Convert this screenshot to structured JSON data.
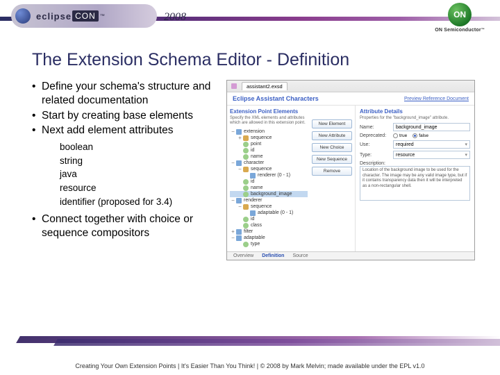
{
  "header": {
    "logo_main": "eclipse",
    "logo_con": "CON",
    "tm": "™",
    "year": "2008",
    "on_text": "ON",
    "on_sub": "ON Semiconductor",
    "on_tm": "™"
  },
  "title": "The Extension Schema Editor - Definition",
  "bullets": {
    "b1": "Define your schema's structure and related documentation",
    "b2": "Start by creating base elements",
    "b3": "Next add element attributes",
    "sub1": "boolean",
    "sub2": "string",
    "sub3": "java",
    "sub4": "resource",
    "sub5": "identifier (proposed for 3.4)",
    "b4": "Connect together with choice or sequence compositors"
  },
  "panel": {
    "tab_file": "assistant2.exsd",
    "doc_title": "Eclipse Assistant Characters",
    "doc_link": "Preview Reference Document",
    "tree_heading": "Extension Point Elements",
    "tree_desc": "Specify the XML elements and attributes which are allowed in this extension point.",
    "btn_new_element": "New Element",
    "btn_new_attribute": "New Attribute",
    "btn_new_choice": "New Choice",
    "btn_new_sequence": "New Sequence",
    "btn_remove": "Remove",
    "details_heading": "Attribute Details",
    "details_desc": "Properties for the \"background_image\" attribute.",
    "name_label": "Name:",
    "name_value": "background_image",
    "deprecated_label": "Deprecated:",
    "dep_true": "true",
    "dep_false": "false",
    "use_label": "Use:",
    "use_value": "required",
    "type_label": "Type:",
    "type_value": "resource",
    "desc_label": "Description:",
    "desc_text": "Location of the background image to be used for the character. The image may be any valid image type, but if it contains transparency data then it will be interpreted as a non-rectangular shell.",
    "tabs": {
      "overview": "Overview",
      "definition": "Definition",
      "source": "Source"
    },
    "tree": {
      "extension": "extension",
      "sequence": "sequence",
      "point": "point",
      "id": "id",
      "name": "name",
      "character": "character",
      "renderer0": "renderer (0 - 1)",
      "background_image": "background_image",
      "renderer": "renderer",
      "adaptable01": "adaptable (0 - 1)",
      "class_attr": "class",
      "filter": "filter",
      "adaptable": "adaptable",
      "type": "type"
    }
  },
  "footer": "Creating Your Own Extension Points  |  It's Easier Than You Think!  |  © 2008 by Mark Melvin; made available under the EPL v1.0"
}
